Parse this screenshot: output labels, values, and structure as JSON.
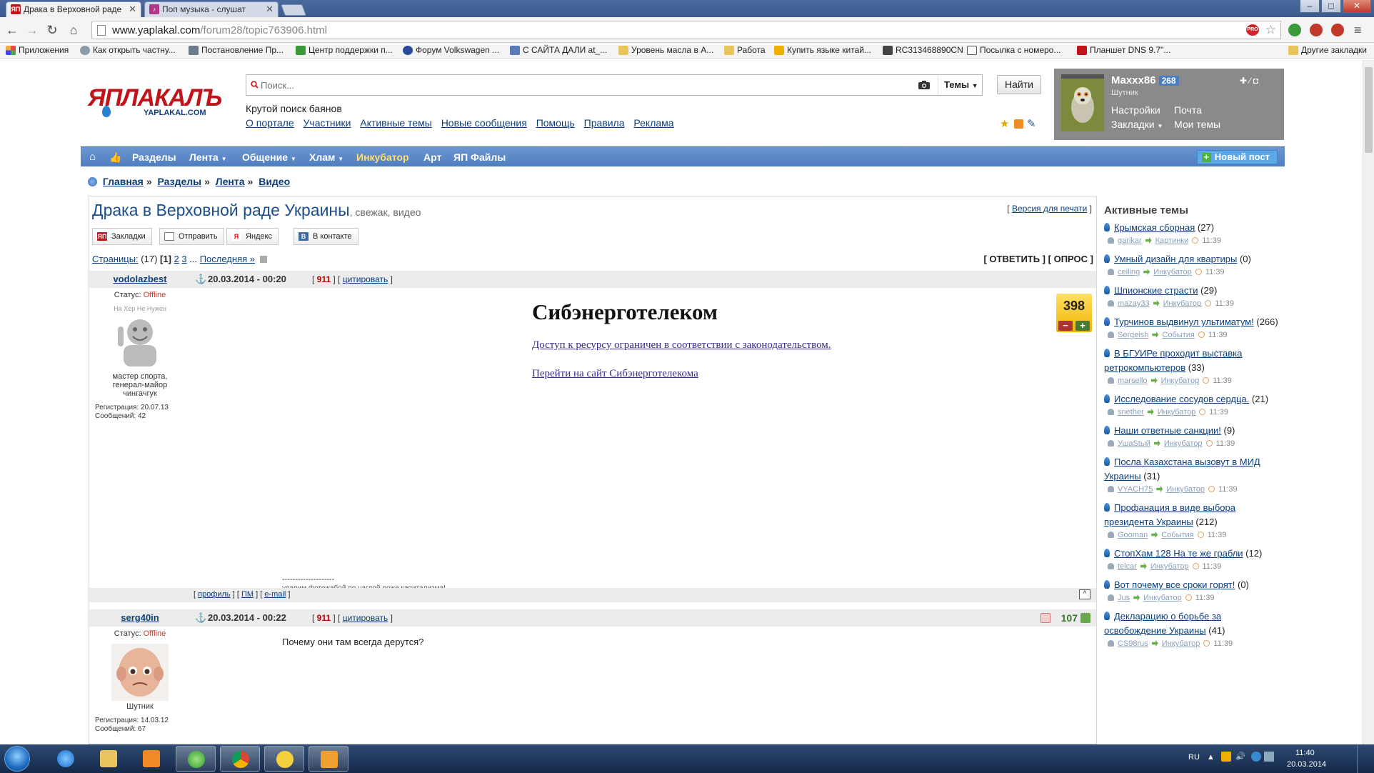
{
  "browser": {
    "tabs": [
      {
        "title": "Драка в Верховной раде",
        "active": true
      },
      {
        "title": "Поп музыка - слушат",
        "active": false
      }
    ],
    "url_base": "www.yaplakal.com",
    "url_path": "/forum28/topic763906.html",
    "bookmarks": [
      "Приложения",
      "Как открыть частну...",
      "Постановление Пр...",
      "Центр поддержки п...",
      "Форум Volkswagen ...",
      "С САЙТА ДАЛИ at_...",
      "Уровень масла в А...",
      "Работа",
      "Купить языке китай...",
      "RC313468890CN",
      "Посылка с номеро...",
      "Планшет DNS 9.7\"...",
      "Другие закладки"
    ]
  },
  "header": {
    "logo_text": "ЯПЛАКАЛЪ",
    "logo_sub": "YAPLAKAL.COM",
    "search_placeholder": "Поиск...",
    "themes_label": "Темы",
    "find_button": "Найти",
    "tagline": "Крутой поиск баянов",
    "top_links": [
      "О портале",
      "Участники",
      "Активные темы",
      "Новые сообщения",
      "Помощь",
      "Правила",
      "Реклама"
    ]
  },
  "user": {
    "name": "Maxxx86",
    "karma": "268",
    "role": "Шутник",
    "links": {
      "settings": "Настройки",
      "mail": "Почта",
      "bookmarks": "Закладки",
      "my_topics": "Мои темы"
    }
  },
  "navbar": {
    "items": [
      "Разделы",
      "Лента",
      "Общение",
      "Хлам",
      "Инкубатор",
      "Арт",
      "ЯП Файлы"
    ],
    "new_post": "Новый пост"
  },
  "breadcrumb": [
    "Главная",
    "Разделы",
    "Лента",
    "Видео"
  ],
  "topic": {
    "title": "Драка в Верховной раде Украины",
    "subtitle": ", свежак, видео",
    "print_link": "Версия для печати",
    "share_buttons": [
      "Закладки",
      "Отправить",
      "Яндекс",
      "В контакте"
    ],
    "pages_label": "Страницы:",
    "pages_count": "(17)",
    "page_current": "[1]",
    "page_links": [
      "2",
      "3"
    ],
    "page_last": "Последняя »",
    "reply": "[ ОТВЕТИТЬ ]",
    "poll": "[ ОПРОС ]"
  },
  "posts": [
    {
      "author": "vodolazbest",
      "date": "20.03.2014 - 00:20",
      "number": "911",
      "quote": "цитировать",
      "status_label": "Статус:",
      "status": "Offline",
      "avatar_caption": "На Хер Не Нужен",
      "rank": "мастер спорта, генерал-майор чингачгук",
      "registered": "Регистрация: 20.07.13",
      "messages": "Сообщений: 42",
      "blocked_title": "Сибэнерготелеком",
      "blocked_msg": "Доступ к ресурсу ограничен в соответствии с законодательством.",
      "blocked_link": "Перейти на сайт Сибэнерготелекома",
      "rating": "398",
      "signature_sep": "--------------------",
      "signature": "ударим фотожабой по наглой роже капитализма!",
      "foot_links": [
        "профиль",
        "ПМ",
        "e-mail"
      ]
    },
    {
      "author": "serg40in",
      "date": "20.03.2014 - 00:22",
      "number": "911",
      "quote": "цитировать",
      "status_label": "Статус:",
      "status": "Offline",
      "rank": "Шутник",
      "registered": "Регистрация: 14.03.12",
      "messages": "Сообщений: 67",
      "text": "Почему они там всегда дерутся?",
      "rating": "107"
    }
  ],
  "active_topics": {
    "heading": "Активные темы",
    "time": "11:39",
    "items": [
      {
        "title": "Крымская сборная",
        "count": "(27)",
        "user": "garikar",
        "section": "Картинки"
      },
      {
        "title": "Умный дизайн для квартиры",
        "count": "(0)",
        "user": "ceiling",
        "section": "Инкубатор"
      },
      {
        "title": "Шпионские страсти",
        "count": "(29)",
        "user": "mazay33",
        "section": "Инкубатор"
      },
      {
        "title": "Турчинов выдвинул ультиматум!",
        "count": "(266)",
        "user": "Sergeish",
        "section": "События"
      },
      {
        "title": "В БГУИРе проходит выставка ретрокомпьютеров",
        "count": "(33)",
        "user": "marsello",
        "section": "Инкубатор"
      },
      {
        "title": "Исследование сосудов сердца.",
        "count": "(21)",
        "user": "snether",
        "section": "Инкубатор"
      },
      {
        "title": "Наши ответные санкции!",
        "count": "(9)",
        "user": "УшаStый",
        "section": "Инкубатор"
      },
      {
        "title": "Посла Казахстана вызовут в МИД Украины",
        "count": "(31)",
        "user": "VYACH75",
        "section": "Инкубатор"
      },
      {
        "title": "Профанация в виде выбора президента Украины",
        "count": "(212)",
        "user": "Gooman",
        "section": "События"
      },
      {
        "title": "СтопХам 128 На те же грабли",
        "count": "(12)",
        "user": "telcar",
        "section": "Инкубатор"
      },
      {
        "title": "Вот почему все сроки горят!",
        "count": "(0)",
        "user": "Jus",
        "section": "Инкубатор"
      },
      {
        "title": "Декларацию о борьбе за освобождение Украины",
        "count": "(41)",
        "user": "CS98rus",
        "section": "Инкубатор"
      }
    ]
  },
  "taskbar": {
    "lang": "RU",
    "clock_time": "11:40",
    "clock_date": "20.03.2014"
  }
}
